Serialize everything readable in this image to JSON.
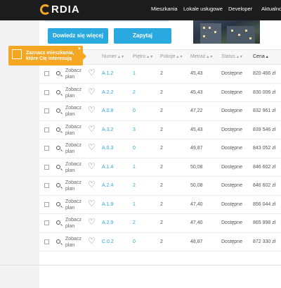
{
  "brand": {
    "logo_text": "RDIA",
    "accent": "#f5a623"
  },
  "nav": {
    "items": [
      "Mieszkania",
      "Lokale usługowe",
      "Developer",
      "Aktualno"
    ]
  },
  "actions": {
    "more_info_label": "Dowiedz się więcej",
    "ask_label": "Zapytaj"
  },
  "tooltip": {
    "text": "Zaznacz mieszkania, które Cię interesują",
    "close": "×"
  },
  "table": {
    "headers": {
      "number": "Numer",
      "floor": "Piętro",
      "rooms": "Pokoje",
      "area": "Metraż",
      "status": "Status",
      "price": "Cena"
    },
    "plan_label_line1": "Zobacz",
    "plan_label_line2": "plan",
    "rows": [
      {
        "number": "A.1.2",
        "floor": "1",
        "rooms": "2",
        "area": "45,43",
        "status": "Dostępne",
        "price": "820 466 zł"
      },
      {
        "number": "A.2.2",
        "floor": "2",
        "rooms": "2",
        "area": "45,43",
        "status": "Dostępne",
        "price": "830 006 zł"
      },
      {
        "number": "A.0.8",
        "floor": "0",
        "rooms": "2",
        "area": "47,22",
        "status": "Dostępne",
        "price": "832 961 zł"
      },
      {
        "number": "A.3.2",
        "floor": "3",
        "rooms": "2",
        "area": "45,43",
        "status": "Dostępne",
        "price": "839 546 zł"
      },
      {
        "number": "A.0.3",
        "floor": "0",
        "rooms": "2",
        "area": "49,87",
        "status": "Dostępne",
        "price": "843 052 zł"
      },
      {
        "number": "A.1.4",
        "floor": "1",
        "rooms": "2",
        "area": "50,08",
        "status": "Dostępne",
        "price": "846 602 zł"
      },
      {
        "number": "A.2.4",
        "floor": "2",
        "rooms": "2",
        "area": "50,08",
        "status": "Dostępne",
        "price": "846 602 zł"
      },
      {
        "number": "A.1.9",
        "floor": "1",
        "rooms": "2",
        "area": "47,40",
        "status": "Dostępne",
        "price": "856 044 zł"
      },
      {
        "number": "A.2.9",
        "floor": "2",
        "rooms": "2",
        "area": "47,40",
        "status": "Dostępne",
        "price": "865 998 zł"
      },
      {
        "number": "C.0.2",
        "floor": "0",
        "rooms": "2",
        "area": "48,87",
        "status": "Dostępne",
        "price": "872 330 zł"
      }
    ]
  }
}
